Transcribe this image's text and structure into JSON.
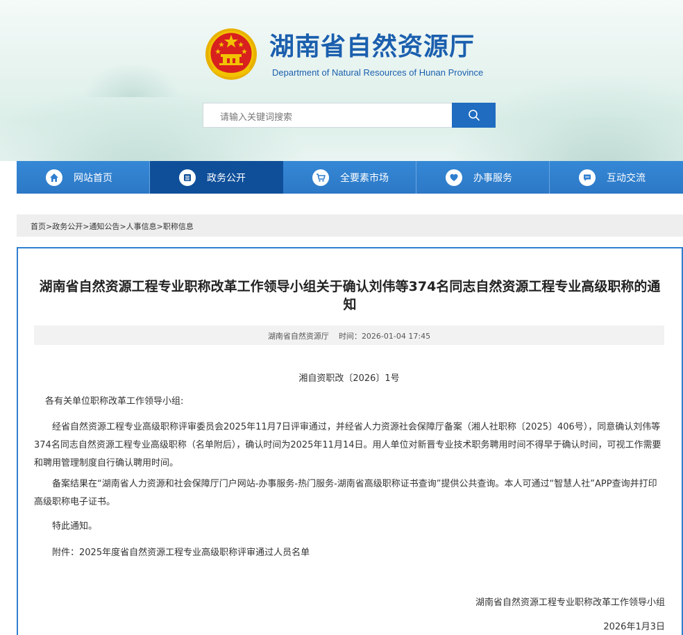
{
  "header": {
    "site_title": "湖南省自然资源厅",
    "site_subtitle": "Department of Natural Resources of Hunan Province",
    "search_placeholder": "请输入关键词搜索"
  },
  "nav": {
    "items": [
      {
        "label": "网站首页",
        "icon": "home-icon"
      },
      {
        "label": "政务公开",
        "icon": "document-list-icon"
      },
      {
        "label": "全要素市场",
        "icon": "shopping-cart-icon"
      },
      {
        "label": "办事服务",
        "icon": "service-icon"
      },
      {
        "label": "互动交流",
        "icon": "chat-icon"
      }
    ],
    "active_index": 1
  },
  "breadcrumb": {
    "items": [
      "首页",
      "政务公开",
      "通知公告",
      "人事信息",
      "职称信息"
    ],
    "separator": ">"
  },
  "article": {
    "title": "湖南省自然资源工程专业职称改革工作领导小组关于确认刘伟等374名同志自然资源工程专业高级职称的通知",
    "source": "湖南省自然资源厅",
    "time_label": "时间：",
    "time": "2026-01-04 17:45",
    "doc_number": "湘自资职改〔2026〕1号",
    "salutation": "各有关单位职称改革工作领导小组:",
    "paragraphs": [
      "经省自然资源工程专业高级职称评审委员会2025年11月7日评审通过，并经省人力资源社会保障厅备案（湘人社职称〔2025〕406号），同意确认刘伟等374名同志自然资源工程专业高级职称（名单附后），确认时间为2025年11月14日。用人单位对新晋专业技术职务聘用时间不得早于确认时间，可视工作需要和聘用管理制度自行确认聘用时间。",
      "备案结果在“湖南省人力资源和社会保障厅门户网站-办事服务-热门服务-湖南省高级职称证书查询”提供公共查询。本人可通过“智慧人社”APP查询并打印高级职称电子证书。",
      "特此通知。",
      "附件：2025年度省自然资源工程专业高级职称评审通过人员名单"
    ],
    "signature_org": "湖南省自然资源工程专业职称改革工作领导小组",
    "signature_date": "2026年1月3日"
  },
  "colors": {
    "brand_blue": "#1b5fae",
    "nav_blue": "#2f7fd0",
    "nav_active": "#0f4f9a",
    "emblem_red": "#d8201f",
    "emblem_gold": "#f2c200"
  }
}
